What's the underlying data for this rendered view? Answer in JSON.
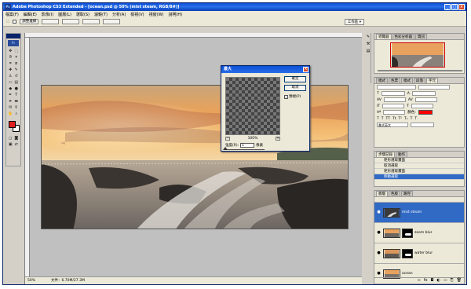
{
  "window": {
    "title": "Adobe Photoshop CS3 Extended - [ocean.psd @ 50% (mist steam, RGB/8#)]"
  },
  "menu": [
    "檔案(F)",
    "編輯(E)",
    "影像(I)",
    "圖層(L)",
    "選取(S)",
    "濾鏡(T)",
    "分析(A)",
    "檢視(V)",
    "視窗(W)",
    "說明(H)"
  ],
  "options": {
    "refine_edge": "調整邊緣",
    "workspace": "工作區"
  },
  "toolbox": {
    "logo": "Ps"
  },
  "status": {
    "zoom": "50%",
    "doc": "文件：6.70M/27.3M"
  },
  "dialog": {
    "title": "最大",
    "ok": "確定",
    "cancel": "取消",
    "preview_label": "預視(P)",
    "zoom": "100%",
    "radius_label": "強度(R):",
    "radius_value": "1",
    "unit": "像素"
  },
  "navigator": {
    "tabs": [
      "導覽器",
      "色彩分析器",
      "資訊"
    ]
  },
  "character": {
    "tabs": [
      "樣式",
      "色票",
      "樣式",
      "段落",
      "字元"
    ],
    "color_label": "顏色:",
    "lang": "美式英文"
  },
  "history": {
    "tabs": [
      "步驟記錄",
      "動作"
    ],
    "items": [
      "矩形選取畫面",
      "取消選取",
      "矩形選取畫面",
      "移動選取"
    ]
  },
  "layers": {
    "tabs": [
      "圖層",
      "色版",
      "路徑"
    ],
    "items": [
      {
        "name": "mist steam",
        "selected": true,
        "mask": false
      },
      {
        "name": "zoom blur",
        "selected": false,
        "mask": true
      },
      {
        "name": "water blur",
        "selected": false,
        "mask": true
      },
      {
        "name": "ocean",
        "selected": false,
        "mask": false
      }
    ]
  },
  "colors": {
    "title_bar": "#0a4fd8",
    "selection": "#316ac5",
    "foreground": "#e02020",
    "font_color_swatch": "#ff0000"
  }
}
